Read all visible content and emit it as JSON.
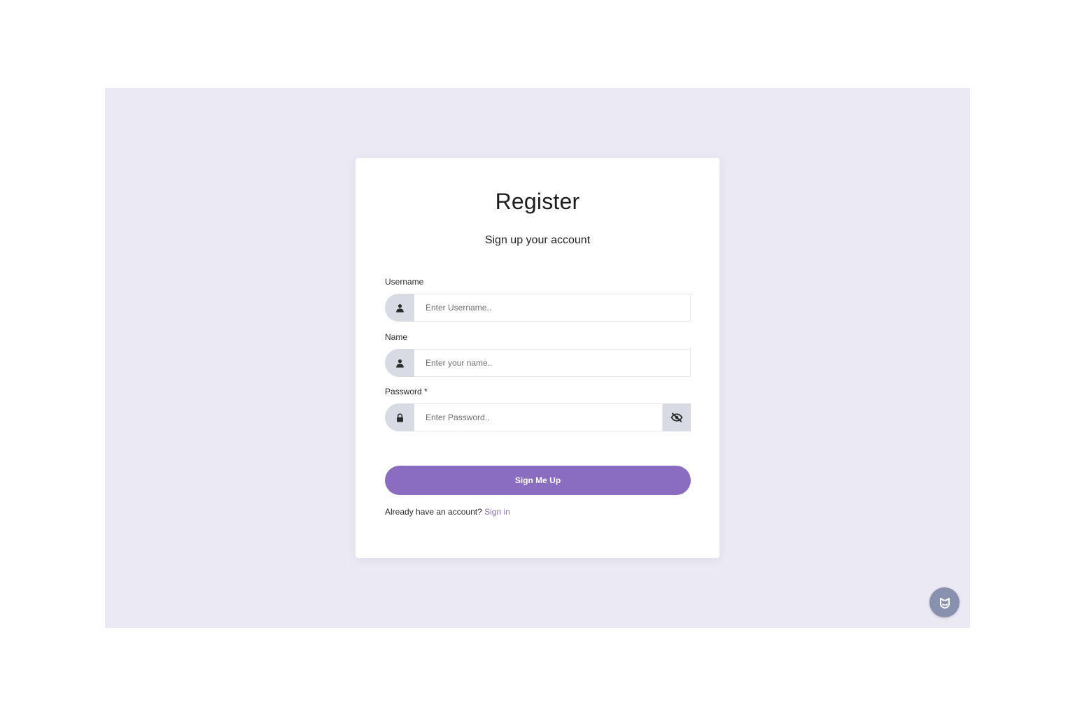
{
  "form": {
    "title": "Register",
    "subtitle": "Sign up your account",
    "username": {
      "label": "Username",
      "placeholder": "Enter Username..",
      "value": "",
      "icon": "user-icon"
    },
    "name": {
      "label": "Name",
      "placeholder": "Enter your name..",
      "value": "",
      "icon": "user-icon"
    },
    "password": {
      "label": "Password *",
      "placeholder": "Enter Password..",
      "value": "",
      "icon": "lock-icon",
      "toggle_icon": "eye-slash-icon"
    },
    "submit_label": "Sign Me Up",
    "footer_text": "Already have an account?",
    "footer_link": "Sign in"
  },
  "floating_badge": {
    "icon": "extension-shield-icon"
  },
  "colors": {
    "page_background": "#ebe9f3",
    "accent": "#8a6cc0",
    "addon_background": "#d9dbe4",
    "badge_background": "#8891ad"
  }
}
